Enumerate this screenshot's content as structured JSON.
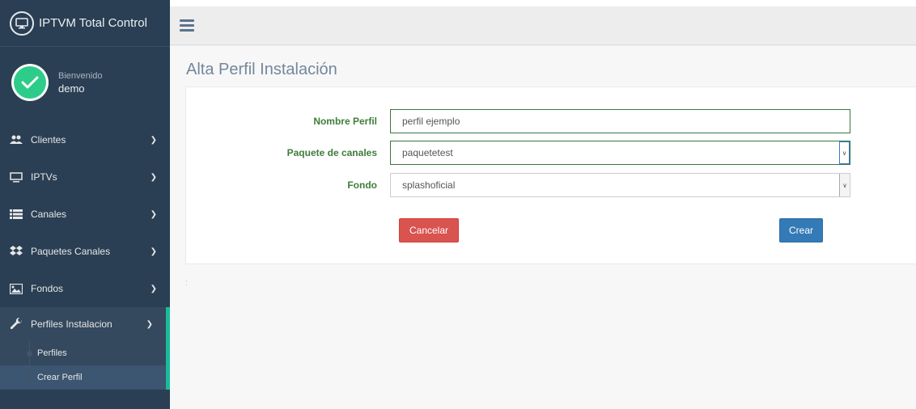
{
  "app": {
    "title": "IPTVM Total Control",
    "icon": "monitor-icon"
  },
  "profile": {
    "welcome": "Bienvenido",
    "username": "demo",
    "avatar_icon": "check-circle-icon",
    "avatar_color": "#2ecc8a"
  },
  "sidebar": {
    "items": [
      {
        "label": "Clientes",
        "icon": "users-icon"
      },
      {
        "label": "IPTVs",
        "icon": "monitor-icon"
      },
      {
        "label": "Canales",
        "icon": "list-icon"
      },
      {
        "label": "Paquetes Canales",
        "icon": "dropbox-icon"
      },
      {
        "label": "Fondos",
        "icon": "image-icon"
      },
      {
        "label": "Perfiles Instalacion",
        "icon": "wrench-icon"
      }
    ],
    "submenu": [
      {
        "label": "Perfiles"
      },
      {
        "label": "Crear Perfil"
      }
    ]
  },
  "page": {
    "title": "Alta Perfil Instalación"
  },
  "form": {
    "nombre_label": "Nombre Perfil",
    "nombre_value": "perfil ejemplo",
    "paquete_label": "Paquete de canales",
    "paquete_value": "paquetetest",
    "fondo_label": "Fondo",
    "fondo_value": "splashoficial",
    "cancel_label": "Cancelar",
    "create_label": "Crear"
  },
  "colors": {
    "sidebar": "#2a3f54",
    "accent": "#1abb9c",
    "danger": "#d9534f",
    "primary": "#337ab7",
    "label_green": "#3f7d3a"
  }
}
